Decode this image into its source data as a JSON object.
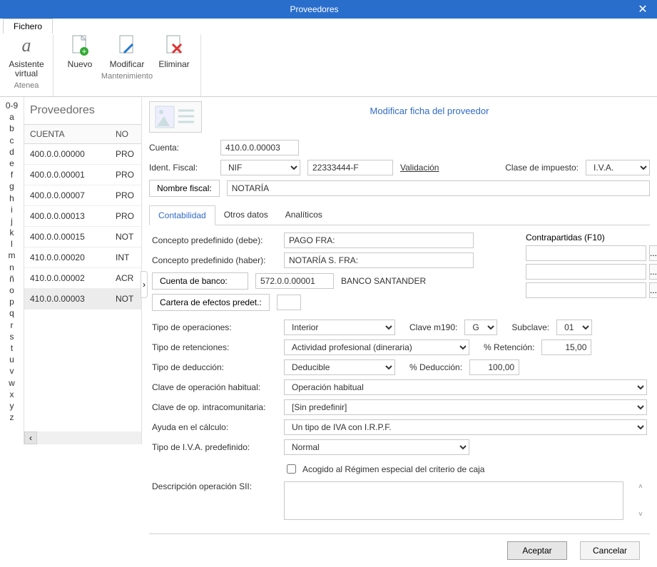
{
  "window": {
    "title": "Proveedores"
  },
  "ribbon": {
    "tab": "Fichero",
    "asistente_top": "Asistente",
    "asistente_bottom": "virtual",
    "asistente_group": "Atenea",
    "nuevo": "Nuevo",
    "modificar": "Modificar",
    "eliminar": "Eliminar",
    "mant_group": "Mantenimiento"
  },
  "az": [
    "0-9",
    "a",
    "b",
    "c",
    "d",
    "e",
    "f",
    "g",
    "h",
    "i",
    "j",
    "k",
    "l",
    "m",
    "n",
    "ñ",
    "o",
    "p",
    "q",
    "r",
    "s",
    "t",
    "u",
    "v",
    "w",
    "x",
    "y",
    "z"
  ],
  "list": {
    "title": "Proveedores",
    "col_cuenta": "CUENTA",
    "col_no": "NO",
    "rows": [
      {
        "cuenta": "400.0.0.00000",
        "no": "PRO"
      },
      {
        "cuenta": "400.0.0.00001",
        "no": "PRO"
      },
      {
        "cuenta": "400.0.0.00007",
        "no": "PRO"
      },
      {
        "cuenta": "400.0.0.00013",
        "no": "PRO"
      },
      {
        "cuenta": "400.0.0.00015",
        "no": "NOT"
      },
      {
        "cuenta": "410.0.0.00020",
        "no": "INT"
      },
      {
        "cuenta": "410.0.0.00002",
        "no": "ACR"
      },
      {
        "cuenta": "410.0.0.00003",
        "no": "NOT"
      }
    ],
    "selected_index": 7
  },
  "detail": {
    "title": "Modificar ficha del proveedor",
    "labels": {
      "cuenta": "Cuenta:",
      "ident": "Ident. Fiscal:",
      "validacion": "Validación",
      "clase_imp": "Clase de impuesto:",
      "nombre_fiscal": "Nombre fiscal:"
    },
    "cuenta": "410.0.0.00003",
    "ident_tipo": "NIF",
    "ident_valor": "22333444-F",
    "clase_imp": "I.V.A.",
    "nombre_fiscal": "NOTARÍA"
  },
  "tabs": {
    "contabilidad": "Contabilidad",
    "otros": "Otros datos",
    "analiticos": "Analíticos"
  },
  "contab": {
    "labels": {
      "cpd": "Concepto predefinido (debe):",
      "cph": "Concepto predefinido (haber):",
      "cuenta_banco": "Cuenta de banco:",
      "cartera": "Cartera de efectos predet.:",
      "tipo_op": "Tipo de operaciones:",
      "clave_m190": "Clave m190:",
      "subclave": "Subclave:",
      "tipo_ret": "Tipo de retenciones:",
      "pct_ret": "% Retención:",
      "tipo_ded": "Tipo de deducción:",
      "pct_ded": "% Deducción:",
      "clave_hab": "Clave de operación habitual:",
      "clave_intra": "Clave de op. intracomunitaria:",
      "ayuda": "Ayuda en el cálculo:",
      "tipo_iva": "Tipo de I.V.A. predefinido:",
      "contrapartidas": "Contrapartidas (F10)",
      "acogido": "Acogido al Régimen especial del criterio de caja",
      "desc_sii": "Descripción operación SII:"
    },
    "cpd": "PAGO FRA:",
    "cph": "NOTARÍA S. FRA:",
    "cuenta_banco": "572.0.0.00001",
    "banco_nombre": "BANCO SANTANDER",
    "cartera": "",
    "tipo_op": "Interior",
    "clave_m190": "G",
    "subclave": "01",
    "tipo_ret": "Actividad profesional (dineraria)",
    "pct_ret": "15,00",
    "tipo_ded": "Deducible",
    "pct_ded": "100,00",
    "clave_hab": "Operación habitual",
    "clave_intra": "[Sin predefinir]",
    "ayuda": "Un tipo de IVA con I.R.P.F.",
    "tipo_iva": "Normal",
    "desc_sii": "",
    "ellipsis": "..."
  },
  "footer": {
    "aceptar": "Aceptar",
    "cancelar": "Cancelar"
  }
}
